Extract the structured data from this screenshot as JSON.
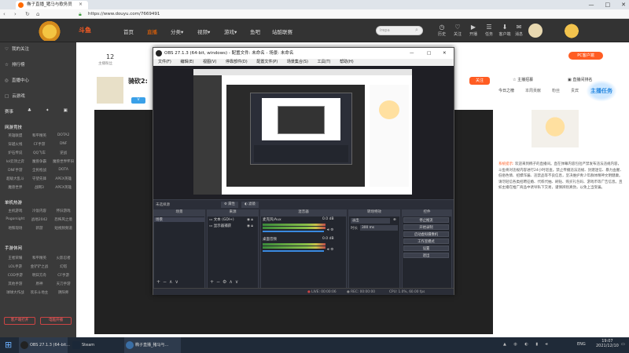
{
  "browser": {
    "tab_title": "椭子直播_猪马与歌务员",
    "url": "https://www.douyu.com/7669491",
    "window_buttons": [
      "—",
      "□",
      "✕"
    ]
  },
  "header": {
    "brand": "斗鱼",
    "nav": [
      "首页",
      "直播",
      "分类",
      "视频",
      "游戏",
      "鱼吧",
      "站酷联赛"
    ],
    "nav_arrows": [
      "",
      "",
      "▾",
      "▾",
      "▾",
      "",
      ""
    ],
    "search_placeholder": "lrepa",
    "icons": [
      {
        "name": "history-icon",
        "label": "历史",
        "glyph": "◷"
      },
      {
        "name": "follow-icon",
        "label": "关注",
        "glyph": "♡"
      },
      {
        "name": "live-icon",
        "label": "开播",
        "glyph": "▶"
      },
      {
        "name": "task-icon",
        "label": "任务",
        "glyph": "☰"
      },
      {
        "name": "customer-icon",
        "label": "客户端",
        "glyph": "⬇"
      },
      {
        "name": "message-icon",
        "label": "消息",
        "glyph": "✉"
      }
    ]
  },
  "sidebar": {
    "main": [
      {
        "icon": "♡",
        "label": "我的关注"
      },
      {
        "icon": "☆",
        "label": "排行榜"
      },
      {
        "icon": "◎",
        "label": "直播中心"
      },
      {
        "icon": "□",
        "label": "云游戏"
      }
    ],
    "quick_icons": [
      "赛事",
      "♣",
      "✦",
      "▣"
    ],
    "sections": [
      {
        "title": "网游竞技",
        "items": [
          "英雄联盟",
          "和平精英",
          "DOTA2",
          "穿越火线",
          "CF手游",
          "DNF",
          "炉石传说",
          "QQ飞车",
          "逆战",
          "lol云顶之弈",
          "魔兽争霸",
          "魔兽世界怀旧",
          "DNF手游",
          "全民枪战",
          "DOTA",
          "超级大乱斗",
          "守望先锋",
          "APEX英雄",
          "魔兽世界",
          "战网3",
          "APEX英雄"
        ]
      },
      {
        "title": "单机热游",
        "items": [
          "主机游戏",
          "冷饭内容",
          "怀旧游戏",
          "Pogorsight",
          "战地2042",
          "恐怖风之境",
          "地铁现场",
          "新游",
          "短视频频道"
        ]
      },
      {
        "title": "手游休闲",
        "items": [
          "王者荣耀",
          "和平精英",
          "火影忍者",
          "LOL手游",
          "金铲铲之战",
          "幻塔",
          "COD手游",
          "明日方舟",
          "CF手游",
          "其他手游",
          "原神",
          "天刀手游",
          "球球大作战",
          "欢乐斗地主",
          "阴阳师"
        ]
      }
    ],
    "bottom_buttons": [
      "客户端打开",
      "电脑开播"
    ]
  },
  "room": {
    "title": "骑砍2:",
    "follow_count": "12",
    "follow_label": "主播粉丝",
    "follow_btn": "关注",
    "tag": "V"
  },
  "right_panel": {
    "tabs": [
      "今日之榜",
      "本周贡献",
      "粉丝",
      "贵宾"
    ],
    "top_tabs": [
      "主播招募",
      "直播间排名"
    ],
    "notice_label": "系统提示:",
    "notice_text": "欢迎来到椭子的直播间。直在弹幕内容包括严禁发布违法违规内容，斗鱼将对违规内容进行24小时巡查。禁止传播违法违规、封建迷信、暴力血腥、低俗色情、招嫖诈骗、违禁品等不良信息，坚决维护青少年群体精神文明健康。请勿轻信各类招聘征婚、代练代抽、刷钻、购买礼包码、游戏币等广告信息。且如主播在推广商品中诱导私下交易，谨慎辨别真伪，以免上当受骗。",
    "badge": "PC客户端",
    "promo": "主播任务"
  },
  "obs": {
    "title": "OBS 27.1.3 (64-bit, windows) - 配置文件: 未命名 - 场景: 未命名",
    "menu": [
      "文件(F)",
      "编辑(E)",
      "视图(V)",
      "停靠部件(D)",
      "配置文件(P)",
      "场景集合(S)",
      "工具(T)",
      "帮助(H)"
    ],
    "source_label": "未选择源",
    "props_btn": "属性",
    "filters_btn": "滤镜",
    "docks": {
      "scenes": "场景",
      "sources": "来源",
      "mixer": "混音器",
      "transitions": "转场特效",
      "controls": "控件"
    },
    "scenes": [
      "场景"
    ],
    "sources": [
      "文本 (GDI+)",
      "显示器捕获"
    ],
    "mixer": [
      {
        "name": "麦克风/Aux",
        "db": "0.0 dB"
      },
      {
        "name": "桌面音频",
        "db": "0.0 dB"
      }
    ],
    "transition": {
      "name": "淡出",
      "duration_label": "时长",
      "duration": "300 ms"
    },
    "controls": [
      "停止推流",
      "开始录制",
      "启动虚拟摄像机",
      "工作室模式",
      "设置",
      "退出"
    ],
    "status": {
      "live": "LIVE: 00:00:06",
      "rec": "REC: 00:00:00",
      "cpu": "CPU: 1.0%, 60.00 fps"
    }
  },
  "taskbar": {
    "items": [
      {
        "label": "OBS 27.1.3 (64-bit...",
        "color": "#444"
      },
      {
        "label": "Steam",
        "color": "#1b2838"
      },
      {
        "label": "椭子直播_猪马与...",
        "color": "#3a6ea5"
      }
    ],
    "lang": "ENG",
    "time": "19:07",
    "date": "2021/12/10"
  }
}
